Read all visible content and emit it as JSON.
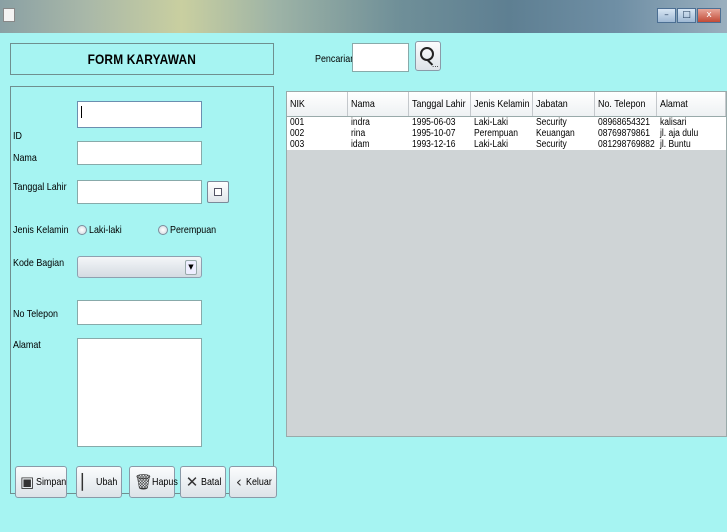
{
  "form": {
    "title": "FORM KARYAWAN",
    "fields": {
      "id_label": "ID",
      "nama_label": "Nama",
      "tanggal_lahir_label": "Tanggal Lahir",
      "jenis_kelamin_label": "Jenis Kelamin",
      "radio_laki": "Laki-laki",
      "radio_perempuan": "Perempuan",
      "kode_bagian_label": "Kode Bagian",
      "no_telepon_label": "No Telepon",
      "alamat_label": "Alamat"
    },
    "buttons": {
      "simpan": "Simpan",
      "ubah": "Ubah",
      "hapus": "Hapus",
      "batal": "Batal",
      "keluar": "Keluar"
    }
  },
  "search": {
    "label": "Pencarian",
    "button_label": "..."
  },
  "table": {
    "columns": [
      "NIK",
      "Nama",
      "Tanggal Lahir",
      "Jenis Kelamin",
      "Jabatan",
      "No. Telepon",
      "Alamat"
    ],
    "rows": [
      [
        "001",
        "indra",
        "1995-06-03",
        "Laki-Laki",
        "Security",
        "08968654321",
        "kalisari"
      ],
      [
        "002",
        "rina",
        "1995-10-07",
        "Perempuan",
        "Keuangan",
        "08769879861",
        "jl. aja dulu"
      ],
      [
        "003",
        "idam",
        "1993-12-16",
        "Laki-Laki",
        "Security",
        "081298769882",
        "jl. Buntu"
      ]
    ]
  },
  "window": {
    "minimize": "–",
    "maximize": "□",
    "close": "x"
  }
}
